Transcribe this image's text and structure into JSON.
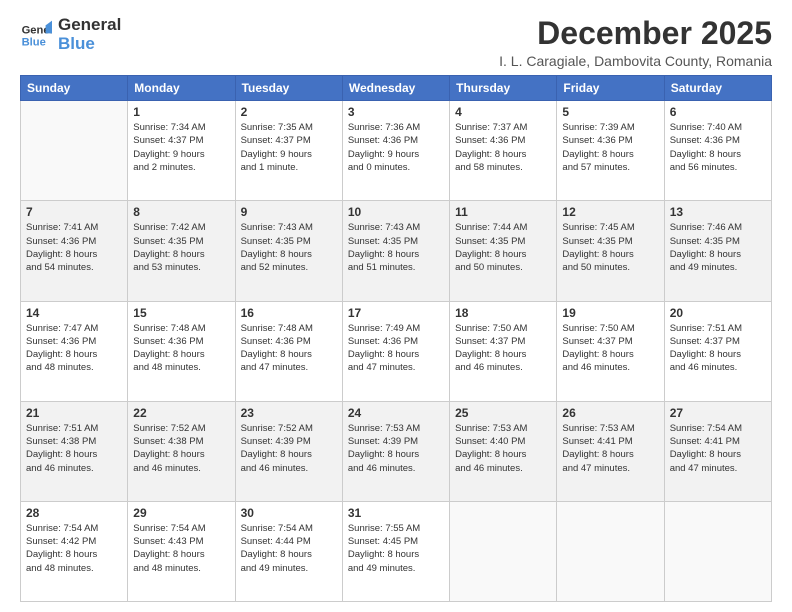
{
  "logo": {
    "line1": "General",
    "line2": "Blue"
  },
  "title": "December 2025",
  "subtitle": "I. L. Caragiale, Dambovita County, Romania",
  "headers": [
    "Sunday",
    "Monday",
    "Tuesday",
    "Wednesday",
    "Thursday",
    "Friday",
    "Saturday"
  ],
  "weeks": [
    [
      {
        "day": "",
        "detail": ""
      },
      {
        "day": "1",
        "detail": "Sunrise: 7:34 AM\nSunset: 4:37 PM\nDaylight: 9 hours\nand 2 minutes."
      },
      {
        "day": "2",
        "detail": "Sunrise: 7:35 AM\nSunset: 4:37 PM\nDaylight: 9 hours\nand 1 minute."
      },
      {
        "day": "3",
        "detail": "Sunrise: 7:36 AM\nSunset: 4:36 PM\nDaylight: 9 hours\nand 0 minutes."
      },
      {
        "day": "4",
        "detail": "Sunrise: 7:37 AM\nSunset: 4:36 PM\nDaylight: 8 hours\nand 58 minutes."
      },
      {
        "day": "5",
        "detail": "Sunrise: 7:39 AM\nSunset: 4:36 PM\nDaylight: 8 hours\nand 57 minutes."
      },
      {
        "day": "6",
        "detail": "Sunrise: 7:40 AM\nSunset: 4:36 PM\nDaylight: 8 hours\nand 56 minutes."
      }
    ],
    [
      {
        "day": "7",
        "detail": "Sunrise: 7:41 AM\nSunset: 4:36 PM\nDaylight: 8 hours\nand 54 minutes."
      },
      {
        "day": "8",
        "detail": "Sunrise: 7:42 AM\nSunset: 4:35 PM\nDaylight: 8 hours\nand 53 minutes."
      },
      {
        "day": "9",
        "detail": "Sunrise: 7:43 AM\nSunset: 4:35 PM\nDaylight: 8 hours\nand 52 minutes."
      },
      {
        "day": "10",
        "detail": "Sunrise: 7:43 AM\nSunset: 4:35 PM\nDaylight: 8 hours\nand 51 minutes."
      },
      {
        "day": "11",
        "detail": "Sunrise: 7:44 AM\nSunset: 4:35 PM\nDaylight: 8 hours\nand 50 minutes."
      },
      {
        "day": "12",
        "detail": "Sunrise: 7:45 AM\nSunset: 4:35 PM\nDaylight: 8 hours\nand 50 minutes."
      },
      {
        "day": "13",
        "detail": "Sunrise: 7:46 AM\nSunset: 4:35 PM\nDaylight: 8 hours\nand 49 minutes."
      }
    ],
    [
      {
        "day": "14",
        "detail": "Sunrise: 7:47 AM\nSunset: 4:36 PM\nDaylight: 8 hours\nand 48 minutes."
      },
      {
        "day": "15",
        "detail": "Sunrise: 7:48 AM\nSunset: 4:36 PM\nDaylight: 8 hours\nand 48 minutes."
      },
      {
        "day": "16",
        "detail": "Sunrise: 7:48 AM\nSunset: 4:36 PM\nDaylight: 8 hours\nand 47 minutes."
      },
      {
        "day": "17",
        "detail": "Sunrise: 7:49 AM\nSunset: 4:36 PM\nDaylight: 8 hours\nand 47 minutes."
      },
      {
        "day": "18",
        "detail": "Sunrise: 7:50 AM\nSunset: 4:37 PM\nDaylight: 8 hours\nand 46 minutes."
      },
      {
        "day": "19",
        "detail": "Sunrise: 7:50 AM\nSunset: 4:37 PM\nDaylight: 8 hours\nand 46 minutes."
      },
      {
        "day": "20",
        "detail": "Sunrise: 7:51 AM\nSunset: 4:37 PM\nDaylight: 8 hours\nand 46 minutes."
      }
    ],
    [
      {
        "day": "21",
        "detail": "Sunrise: 7:51 AM\nSunset: 4:38 PM\nDaylight: 8 hours\nand 46 minutes."
      },
      {
        "day": "22",
        "detail": "Sunrise: 7:52 AM\nSunset: 4:38 PM\nDaylight: 8 hours\nand 46 minutes."
      },
      {
        "day": "23",
        "detail": "Sunrise: 7:52 AM\nSunset: 4:39 PM\nDaylight: 8 hours\nand 46 minutes."
      },
      {
        "day": "24",
        "detail": "Sunrise: 7:53 AM\nSunset: 4:39 PM\nDaylight: 8 hours\nand 46 minutes."
      },
      {
        "day": "25",
        "detail": "Sunrise: 7:53 AM\nSunset: 4:40 PM\nDaylight: 8 hours\nand 46 minutes."
      },
      {
        "day": "26",
        "detail": "Sunrise: 7:53 AM\nSunset: 4:41 PM\nDaylight: 8 hours\nand 47 minutes."
      },
      {
        "day": "27",
        "detail": "Sunrise: 7:54 AM\nSunset: 4:41 PM\nDaylight: 8 hours\nand 47 minutes."
      }
    ],
    [
      {
        "day": "28",
        "detail": "Sunrise: 7:54 AM\nSunset: 4:42 PM\nDaylight: 8 hours\nand 48 minutes."
      },
      {
        "day": "29",
        "detail": "Sunrise: 7:54 AM\nSunset: 4:43 PM\nDaylight: 8 hours\nand 48 minutes."
      },
      {
        "day": "30",
        "detail": "Sunrise: 7:54 AM\nSunset: 4:44 PM\nDaylight: 8 hours\nand 49 minutes."
      },
      {
        "day": "31",
        "detail": "Sunrise: 7:55 AM\nSunset: 4:45 PM\nDaylight: 8 hours\nand 49 minutes."
      },
      {
        "day": "",
        "detail": ""
      },
      {
        "day": "",
        "detail": ""
      },
      {
        "day": "",
        "detail": ""
      }
    ]
  ]
}
